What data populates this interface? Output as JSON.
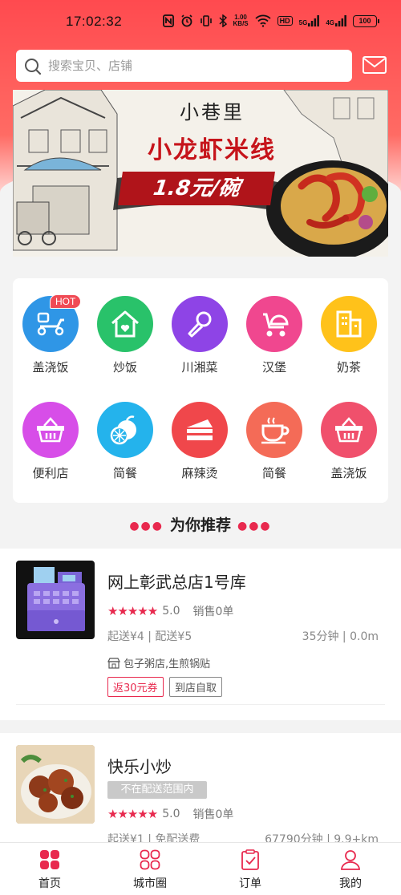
{
  "status_bar": {
    "time": "17:02:32",
    "speed_value": "1.00",
    "speed_unit": "KB/S",
    "hd": "HD",
    "net1": "5G",
    "net2": "4G",
    "battery": "100"
  },
  "search": {
    "placeholder": "搜索宝贝、店铺"
  },
  "banner": {
    "line1": "小巷里",
    "line2": "小龙虾米线",
    "price": "1.8元/碗"
  },
  "categories": [
    {
      "label": "盖浇饭",
      "icon": "scooter-icon",
      "color": "#2f96e6",
      "badge": "HOT"
    },
    {
      "label": "炒饭",
      "icon": "home-heart-icon",
      "color": "#29c26a"
    },
    {
      "label": "川湘菜",
      "icon": "microphone-icon",
      "color": "#8e44e6"
    },
    {
      "label": "汉堡",
      "icon": "stroller-icon",
      "color": "#f0478f"
    },
    {
      "label": "奶茶",
      "icon": "building-icon",
      "color": "#ffc21a"
    },
    {
      "label": "便利店",
      "icon": "basket-icon",
      "color": "#d74ee8"
    },
    {
      "label": "简餐",
      "icon": "orange-icon",
      "color": "#24b3ec"
    },
    {
      "label": "麻辣烫",
      "icon": "cake-icon",
      "color": "#f0474b"
    },
    {
      "label": "简餐",
      "icon": "coffee-icon",
      "color": "#f46b57"
    },
    {
      "label": "盖浇饭",
      "icon": "basket-icon",
      "color": "#f0506c"
    }
  ],
  "recommend": {
    "title": "为你推荐"
  },
  "shops": [
    {
      "name": "网上彰武总店1号库",
      "score": "5.0",
      "sales": "销售0单",
      "fee": "起送¥4 | 配送¥5",
      "distance": "35分钟 | 0.0m",
      "tagline": "包子粥店,生煎锅贴",
      "coupon": "返30元券",
      "pickup": "到店自取"
    },
    {
      "name": "快乐小炒",
      "out_of_range": "不在配送范围内",
      "score": "5.0",
      "sales": "销售0单",
      "fee": "起送¥1 | 免配送费",
      "distance": "67790分钟 | 9.9+km"
    }
  ],
  "tabs": [
    {
      "label": "首页",
      "active": true
    },
    {
      "label": "城市圈",
      "active": false
    },
    {
      "label": "订单",
      "active": false
    },
    {
      "label": "我的",
      "active": false
    }
  ],
  "colors": {
    "accent": "#e8294e",
    "header": "#ff4a4f"
  }
}
